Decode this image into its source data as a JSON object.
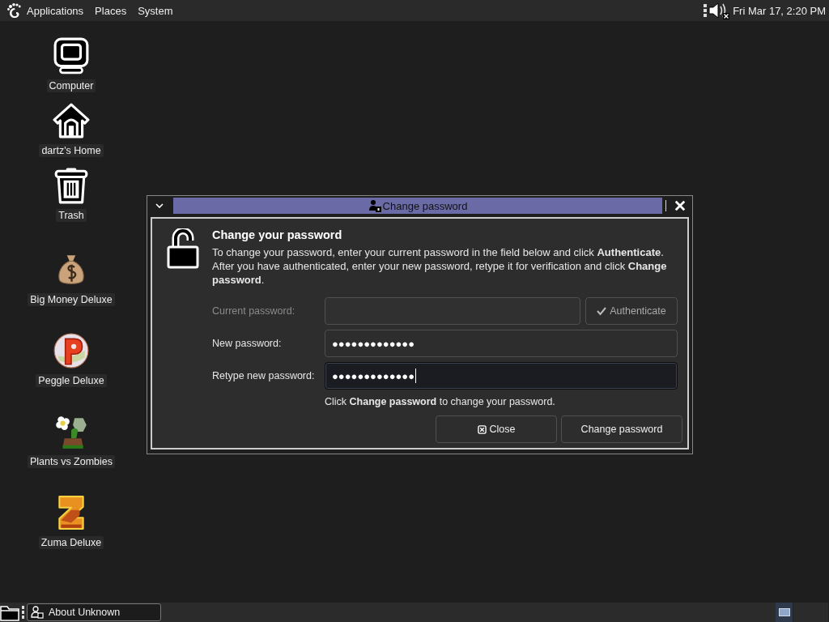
{
  "top_panel": {
    "menus": [
      {
        "label": "Applications"
      },
      {
        "label": "Places"
      },
      {
        "label": "System"
      }
    ],
    "volume_muted": true,
    "clock": "Fri Mar 17,  2:20 PM"
  },
  "desktop_icons": [
    {
      "label": "Computer",
      "kind": "computer"
    },
    {
      "label": "dartz's Home",
      "kind": "home"
    },
    {
      "label": "Trash",
      "kind": "trash"
    },
    {
      "label": "Big Money Deluxe",
      "kind": "moneybag"
    },
    {
      "label": "Peggle Deluxe",
      "kind": "peggle"
    },
    {
      "label": "Plants vs Zombies",
      "kind": "plants"
    },
    {
      "label": "Zuma Deluxe",
      "kind": "zuma"
    }
  ],
  "dialog": {
    "title": "Change password",
    "heading": "Change your password",
    "description": "To change your password, enter your current password in the field below and click **Authenticate**. After you have authenticated, enter your new password, retype it for verification and click **Change password**.",
    "fields": [
      {
        "label": "Current password:",
        "disabled": true,
        "focused": false,
        "button": {
          "label": "Authenticate",
          "disabled": true
        }
      },
      {
        "label": "New password:",
        "value": "●●●●●●●●●●●●●",
        "disabled": false,
        "focused": false
      },
      {
        "label": "Retype new password:",
        "value": "●●●●●●●●●●●●●",
        "disabled": false,
        "focused": true
      }
    ],
    "hint": "Click **Change password** to change your password.",
    "buttons": [
      {
        "label": "Close",
        "kind": "close"
      },
      {
        "label": "Change password",
        "kind": "plain"
      }
    ]
  },
  "taskbar": {
    "tasks": [
      {
        "label": "About Unknown",
        "selected": false
      }
    ],
    "workspaces": [
      {
        "selected": true
      },
      {
        "selected": false
      }
    ]
  }
}
